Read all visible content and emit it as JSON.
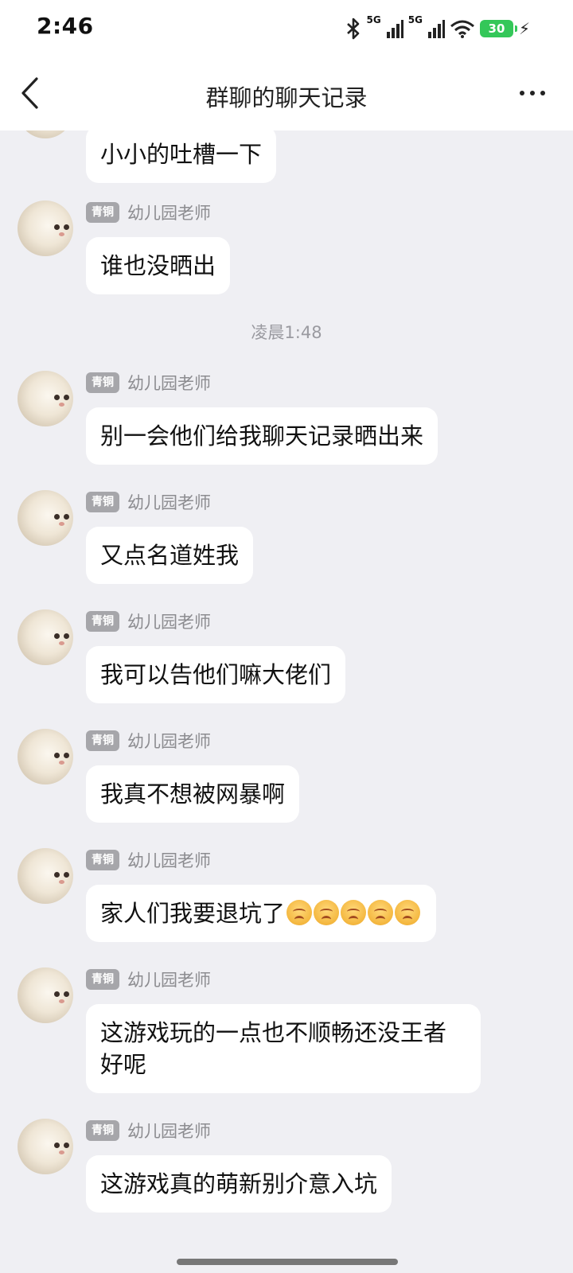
{
  "status_bar": {
    "time": "2:46",
    "network1": "5G",
    "network2": "5G",
    "battery_level": "30"
  },
  "header": {
    "title": "群聊的聊天记录"
  },
  "icons": {
    "back": "chevron-left-icon",
    "more": "more-dots-icon",
    "bluetooth": "bluetooth-icon",
    "signal": "signal-bars-icon",
    "wifi": "wifi-icon",
    "charging": "lightning-icon"
  },
  "chat": {
    "timestamp": "凌晨1:48",
    "messages": [
      {
        "text": "小小的吐槽一下"
      },
      {
        "badge": "青铜",
        "sender": "幼儿园老师",
        "text": "谁也没晒出"
      },
      {
        "badge": "青铜",
        "sender": "幼儿园老师",
        "text": "别一会他们给我聊天记录晒出来"
      },
      {
        "badge": "青铜",
        "sender": "幼儿园老师",
        "text": "又点名道姓我"
      },
      {
        "badge": "青铜",
        "sender": "幼儿园老师",
        "text": "我可以告他们嘛大佬们"
      },
      {
        "badge": "青铜",
        "sender": "幼儿园老师",
        "text": "我真不想被网暴啊"
      },
      {
        "badge": "青铜",
        "sender": "幼儿园老师",
        "text": "家人们我要退坑了",
        "emoji_count": 5
      },
      {
        "badge": "青铜",
        "sender": "幼儿园老师",
        "text": "这游戏玩的一点也不顺畅还没王者好呢"
      },
      {
        "badge": "青铜",
        "sender": "幼儿园老师",
        "text": "这游戏真的萌新别介意入坑"
      }
    ]
  },
  "colors": {
    "background": "#efeff3",
    "bubble": "#ffffff",
    "badge": "#a6a6aa",
    "battery": "#34c759"
  }
}
